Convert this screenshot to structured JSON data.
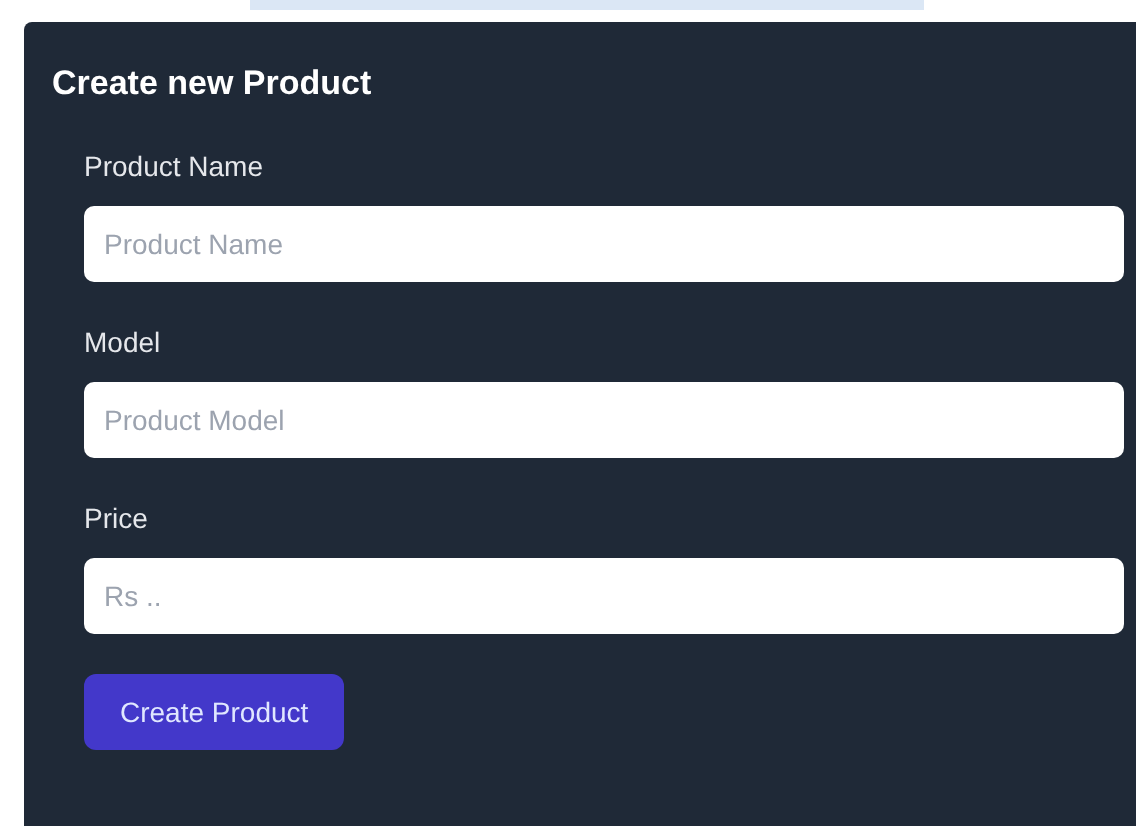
{
  "form": {
    "title": "Create new Product",
    "fields": [
      {
        "label": "Product Name",
        "placeholder": "Product Name"
      },
      {
        "label": "Model",
        "placeholder": "Product Model"
      },
      {
        "label": "Price",
        "placeholder": "Rs .."
      }
    ],
    "submit_button": "Create Product"
  }
}
